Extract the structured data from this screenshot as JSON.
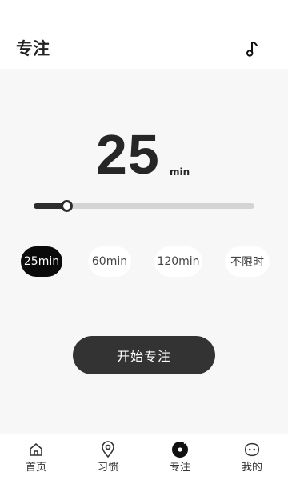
{
  "header": {
    "title": "专注",
    "music_icon": "music-note-icon"
  },
  "timer": {
    "minutes": "25",
    "unit": "min"
  },
  "slider": {
    "value_fraction": 0.15
  },
  "presets": [
    {
      "label": "25min",
      "selected": true
    },
    {
      "label": "60min",
      "selected": false
    },
    {
      "label": "120min",
      "selected": false
    },
    {
      "label": "不限时",
      "selected": false
    }
  ],
  "start_button": {
    "label": "开始专注"
  },
  "nav": {
    "items": [
      {
        "label": "首页",
        "icon": "home-icon"
      },
      {
        "label": "习惯",
        "icon": "location-pin-icon"
      },
      {
        "label": "专注",
        "icon": "focus-disc-icon",
        "active": true
      },
      {
        "label": "我的",
        "icon": "profile-face-icon"
      }
    ]
  },
  "colors": {
    "accent": "#2d2d2d",
    "selected_bg": "#0a0a0a",
    "content_bg": "#f7f7f7",
    "track": "#d4d4d4"
  }
}
